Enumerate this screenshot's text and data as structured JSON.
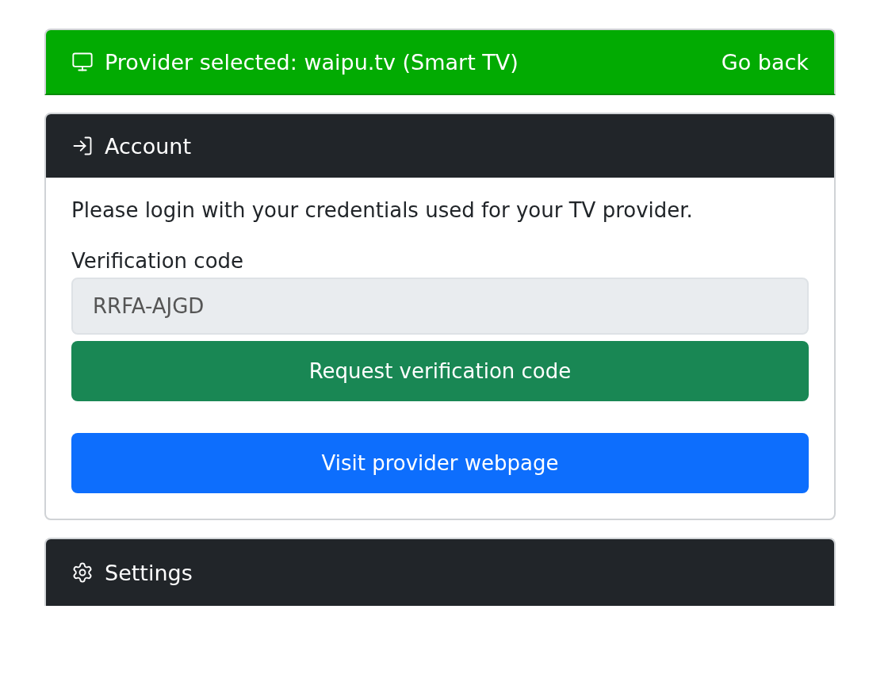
{
  "provider_bar": {
    "title": "Provider selected: waipu.tv (Smart TV)",
    "action": "Go back"
  },
  "account": {
    "title": "Account",
    "intro": "Please login with your credentials used for your TV provider.",
    "field": {
      "label": "Verification code",
      "value": "RRFA-AJGD",
      "disabled": true
    },
    "buttons": [
      {
        "label": "Request verification code",
        "kind": "success"
      },
      {
        "label": "Visit provider webpage",
        "kind": "primary"
      }
    ]
  },
  "settings": {
    "title": "Settings"
  }
}
